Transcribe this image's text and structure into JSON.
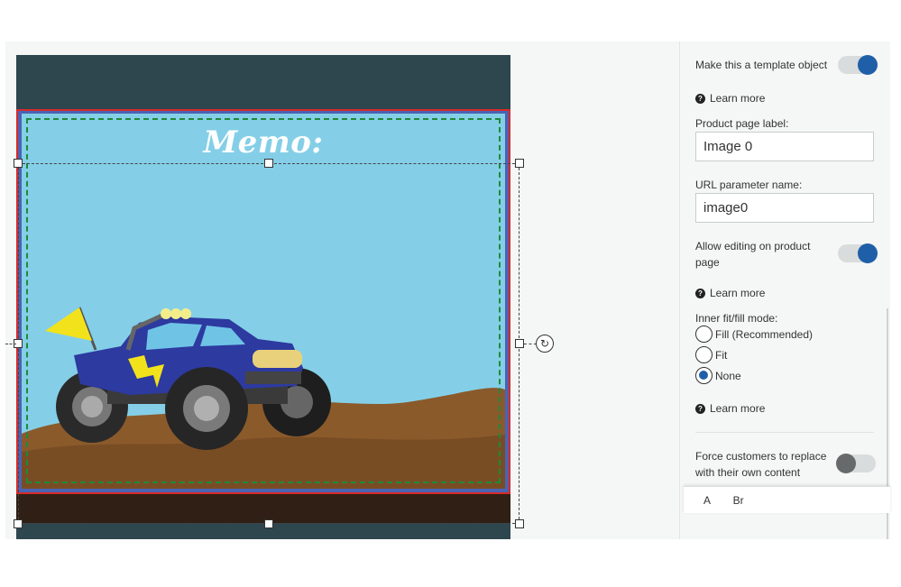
{
  "canvas": {
    "memo_text": "Memo:"
  },
  "panel": {
    "template_object_label": "Make this a template object",
    "template_object_on": true,
    "learn_more_label": "Learn more",
    "product_page_label_title": "Product page label:",
    "product_page_label_value": "Image 0",
    "url_param_title": "URL parameter name:",
    "url_param_value": "image0",
    "allow_editing_label": "Allow editing on product page",
    "allow_editing_on": true,
    "fit_mode_title": "Inner fit/fill mode:",
    "fit_options": [
      "Fill (Recommended)",
      "Fit",
      "None"
    ],
    "fit_selected": "None",
    "force_replace_label": "Force customers to replace with their own content",
    "force_replace_on": false,
    "popup_text": "A Br"
  },
  "colors": {
    "accent": "#1f5fa8",
    "card_bg": "#2e464e",
    "sky": "#84cfe7",
    "bleed_border": "#d62a2a",
    "safe_line": "#1d8a3a"
  }
}
